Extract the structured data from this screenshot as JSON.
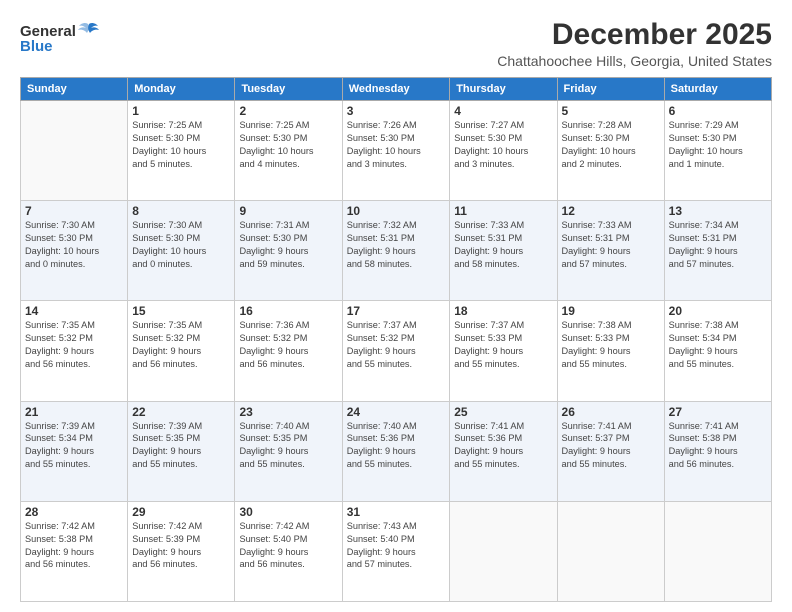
{
  "header": {
    "logo_general": "General",
    "logo_blue": "Blue",
    "month": "December 2025",
    "location": "Chattahoochee Hills, Georgia, United States"
  },
  "weekdays": [
    "Sunday",
    "Monday",
    "Tuesday",
    "Wednesday",
    "Thursday",
    "Friday",
    "Saturday"
  ],
  "weeks": [
    [
      {
        "day": "",
        "info": ""
      },
      {
        "day": "1",
        "info": "Sunrise: 7:25 AM\nSunset: 5:30 PM\nDaylight: 10 hours\nand 5 minutes."
      },
      {
        "day": "2",
        "info": "Sunrise: 7:25 AM\nSunset: 5:30 PM\nDaylight: 10 hours\nand 4 minutes."
      },
      {
        "day": "3",
        "info": "Sunrise: 7:26 AM\nSunset: 5:30 PM\nDaylight: 10 hours\nand 3 minutes."
      },
      {
        "day": "4",
        "info": "Sunrise: 7:27 AM\nSunset: 5:30 PM\nDaylight: 10 hours\nand 3 minutes."
      },
      {
        "day": "5",
        "info": "Sunrise: 7:28 AM\nSunset: 5:30 PM\nDaylight: 10 hours\nand 2 minutes."
      },
      {
        "day": "6",
        "info": "Sunrise: 7:29 AM\nSunset: 5:30 PM\nDaylight: 10 hours\nand 1 minute."
      }
    ],
    [
      {
        "day": "7",
        "info": "Sunrise: 7:30 AM\nSunset: 5:30 PM\nDaylight: 10 hours\nand 0 minutes."
      },
      {
        "day": "8",
        "info": "Sunrise: 7:30 AM\nSunset: 5:30 PM\nDaylight: 10 hours\nand 0 minutes."
      },
      {
        "day": "9",
        "info": "Sunrise: 7:31 AM\nSunset: 5:30 PM\nDaylight: 9 hours\nand 59 minutes."
      },
      {
        "day": "10",
        "info": "Sunrise: 7:32 AM\nSunset: 5:31 PM\nDaylight: 9 hours\nand 58 minutes."
      },
      {
        "day": "11",
        "info": "Sunrise: 7:33 AM\nSunset: 5:31 PM\nDaylight: 9 hours\nand 58 minutes."
      },
      {
        "day": "12",
        "info": "Sunrise: 7:33 AM\nSunset: 5:31 PM\nDaylight: 9 hours\nand 57 minutes."
      },
      {
        "day": "13",
        "info": "Sunrise: 7:34 AM\nSunset: 5:31 PM\nDaylight: 9 hours\nand 57 minutes."
      }
    ],
    [
      {
        "day": "14",
        "info": "Sunrise: 7:35 AM\nSunset: 5:32 PM\nDaylight: 9 hours\nand 56 minutes."
      },
      {
        "day": "15",
        "info": "Sunrise: 7:35 AM\nSunset: 5:32 PM\nDaylight: 9 hours\nand 56 minutes."
      },
      {
        "day": "16",
        "info": "Sunrise: 7:36 AM\nSunset: 5:32 PM\nDaylight: 9 hours\nand 56 minutes."
      },
      {
        "day": "17",
        "info": "Sunrise: 7:37 AM\nSunset: 5:32 PM\nDaylight: 9 hours\nand 55 minutes."
      },
      {
        "day": "18",
        "info": "Sunrise: 7:37 AM\nSunset: 5:33 PM\nDaylight: 9 hours\nand 55 minutes."
      },
      {
        "day": "19",
        "info": "Sunrise: 7:38 AM\nSunset: 5:33 PM\nDaylight: 9 hours\nand 55 minutes."
      },
      {
        "day": "20",
        "info": "Sunrise: 7:38 AM\nSunset: 5:34 PM\nDaylight: 9 hours\nand 55 minutes."
      }
    ],
    [
      {
        "day": "21",
        "info": "Sunrise: 7:39 AM\nSunset: 5:34 PM\nDaylight: 9 hours\nand 55 minutes."
      },
      {
        "day": "22",
        "info": "Sunrise: 7:39 AM\nSunset: 5:35 PM\nDaylight: 9 hours\nand 55 minutes."
      },
      {
        "day": "23",
        "info": "Sunrise: 7:40 AM\nSunset: 5:35 PM\nDaylight: 9 hours\nand 55 minutes."
      },
      {
        "day": "24",
        "info": "Sunrise: 7:40 AM\nSunset: 5:36 PM\nDaylight: 9 hours\nand 55 minutes."
      },
      {
        "day": "25",
        "info": "Sunrise: 7:41 AM\nSunset: 5:36 PM\nDaylight: 9 hours\nand 55 minutes."
      },
      {
        "day": "26",
        "info": "Sunrise: 7:41 AM\nSunset: 5:37 PM\nDaylight: 9 hours\nand 55 minutes."
      },
      {
        "day": "27",
        "info": "Sunrise: 7:41 AM\nSunset: 5:38 PM\nDaylight: 9 hours\nand 56 minutes."
      }
    ],
    [
      {
        "day": "28",
        "info": "Sunrise: 7:42 AM\nSunset: 5:38 PM\nDaylight: 9 hours\nand 56 minutes."
      },
      {
        "day": "29",
        "info": "Sunrise: 7:42 AM\nSunset: 5:39 PM\nDaylight: 9 hours\nand 56 minutes."
      },
      {
        "day": "30",
        "info": "Sunrise: 7:42 AM\nSunset: 5:40 PM\nDaylight: 9 hours\nand 56 minutes."
      },
      {
        "day": "31",
        "info": "Sunrise: 7:43 AM\nSunset: 5:40 PM\nDaylight: 9 hours\nand 57 minutes."
      },
      {
        "day": "",
        "info": ""
      },
      {
        "day": "",
        "info": ""
      },
      {
        "day": "",
        "info": ""
      }
    ]
  ]
}
